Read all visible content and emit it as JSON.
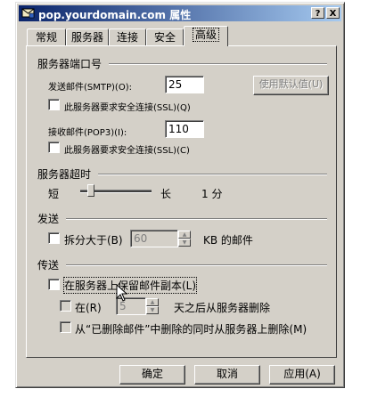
{
  "window": {
    "title": "pop.yourdomain.com 属性"
  },
  "title_buttons": {
    "help": "?",
    "close": "X"
  },
  "tabs": [
    {
      "label": "常规"
    },
    {
      "label": "服务器"
    },
    {
      "label": "连接"
    },
    {
      "label": "安全"
    },
    {
      "label": "高级"
    }
  ],
  "ports": {
    "group_title": "服务器端口号",
    "smtp_label": "发送邮件(SMTP)(O):",
    "smtp_value": "25",
    "default_button": "使用默认值(U)",
    "smtp_ssl_label": "此服务器要求安全连接(SSL)(Q)",
    "pop3_label": "接收邮件(POP3)(I):",
    "pop3_value": "110",
    "pop3_ssl_label": "此服务器要求安全连接(SSL)(C)"
  },
  "timeout": {
    "group_title": "服务器超时",
    "short_label": "短",
    "long_label": "长",
    "value": "1 分"
  },
  "sending": {
    "group_title": "发送",
    "split_label": "拆分大于(B)",
    "split_value": "60",
    "split_unit": "KB 的邮件"
  },
  "delivery": {
    "group_title": "传送",
    "leave_copy_label": "在服务器上保留邮件副本(L)",
    "remove_after_label": "在(R)",
    "remove_after_value": "5",
    "remove_after_suffix": "天之后从服务器删除",
    "remove_deleted_label": "从“已删除邮件”中删除的同时从服务器上删除(M)"
  },
  "footer": {
    "ok": "确定",
    "cancel": "取消",
    "apply": "应用(A)"
  }
}
